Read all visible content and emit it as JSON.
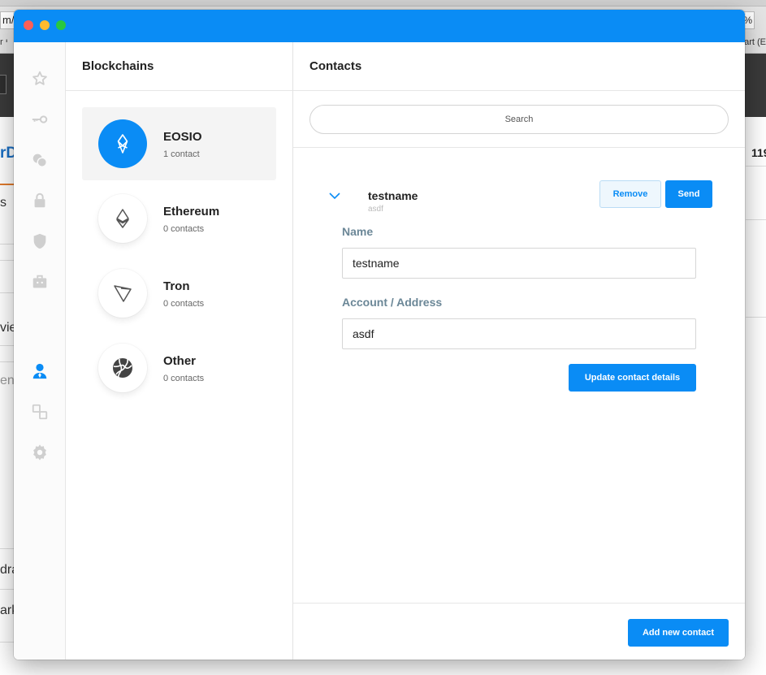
{
  "browser": {
    "url_fragment": "m/",
    "zoom_fragment": "%",
    "bookmark_left_fragment": "r י",
    "bookmark_right_fragment": "art (E",
    "page_fragments": [
      "rD",
      "s",
      "vie",
      "en",
      "dra",
      "ark",
      "119"
    ]
  },
  "sidebar": {
    "items": [
      {
        "icon": "star-icon",
        "active": false
      },
      {
        "icon": "key-icon",
        "active": false
      },
      {
        "icon": "coins-icon",
        "active": false
      },
      {
        "icon": "lock-icon",
        "active": false
      },
      {
        "icon": "shield-icon",
        "active": false
      },
      {
        "icon": "briefcase-icon",
        "active": false
      },
      {
        "icon": "contacts-icon",
        "active": true
      },
      {
        "icon": "exchange-icon",
        "active": false
      },
      {
        "icon": "gear-icon",
        "active": false
      }
    ]
  },
  "blockchains": {
    "title": "Blockchains",
    "items": [
      {
        "name": "EOSIO",
        "count": "1 contact",
        "icon": "eosio-icon",
        "active": true
      },
      {
        "name": "Ethereum",
        "count": "0 contacts",
        "icon": "ethereum-icon",
        "active": false
      },
      {
        "name": "Tron",
        "count": "0 contacts",
        "icon": "tron-icon",
        "active": false
      },
      {
        "name": "Other",
        "count": "0 contacts",
        "icon": "globe-icon",
        "active": false
      }
    ]
  },
  "contacts": {
    "title": "Contacts",
    "search_placeholder": "Search",
    "contact": {
      "name": "testname",
      "address": "asdf",
      "remove_label": "Remove",
      "send_label": "Send"
    },
    "form": {
      "name_label": "Name",
      "name_value": "testname",
      "address_label": "Account / Address",
      "address_value": "asdf",
      "update_label": "Update contact details"
    },
    "add_label": "Add new contact"
  },
  "colors": {
    "accent": "#0a8cf5",
    "label": "#6b8797"
  }
}
